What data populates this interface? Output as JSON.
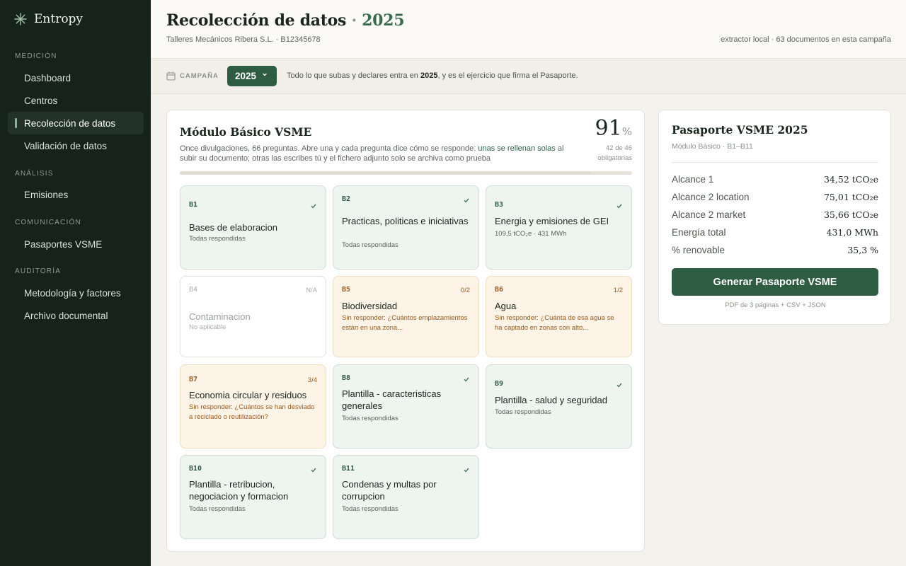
{
  "app": {
    "name": "Entropy"
  },
  "sidebar": {
    "sections": [
      {
        "label": "MEDICIÓN",
        "items": [
          "Dashboard",
          "Centros",
          "Recolección de datos",
          "Validación de datos"
        ]
      },
      {
        "label": "ANÁLISIS",
        "items": [
          "Emisiones"
        ]
      },
      {
        "label": "COMUNICACIÓN",
        "items": [
          "Pasaportes VSME"
        ]
      },
      {
        "label": "AUDITORÍA",
        "items": [
          "Metodología y factores",
          "Archivo documental"
        ]
      }
    ],
    "active_item": "Recolección de datos"
  },
  "header": {
    "title": "Recolección de datos",
    "title_sep": "·",
    "title_year": "2025",
    "company": "Talleres Mecánicos Ribera S.L. · B12345678",
    "right_info": "extractor local · 63 documentos en esta campaña"
  },
  "campaign": {
    "label": "CAMPAÑA",
    "selected_year": "2025",
    "hint_before": "Todo lo que subas y declares entra en ",
    "hint_year": "2025",
    "hint_after": ", y es el ejercicio que firma el Pasaporte."
  },
  "module": {
    "title": "Módulo Básico VSME",
    "desc_before": "Once divulgaciones, 66 preguntas. Abre una y cada pregunta dice cómo se responde: ",
    "desc_highlight": "unas se rellenan solas",
    "desc_after": " al subir su documento; otras las escribes tú y el fichero adjunto solo se archiva como prueba",
    "score": "91",
    "score_unit": "%",
    "score_sub": "42 de 46 obligatorias",
    "progress_fraction": 0.91
  },
  "cards": [
    {
      "code": "B1",
      "title": "Bases de elaboracion",
      "status": "Todas respondidas",
      "state": "done",
      "badge": ""
    },
    {
      "code": "B2",
      "title": "Practicas, politicas e iniciativas",
      "status": "Todas respondidas",
      "state": "done",
      "badge": ""
    },
    {
      "code": "B3",
      "title": "Energia y emisiones de GEI",
      "status": "109,5 tCO₂e · 431 MWh",
      "state": "done",
      "badge": ""
    },
    {
      "code": "B4",
      "title": "Contaminacion",
      "status": "No aplicable",
      "state": "na",
      "badge": "N/A"
    },
    {
      "code": "B5",
      "title": "Biodiversidad",
      "status": "Sin responder: ¿Cuántos emplazamientos están en una zona...",
      "state": "pending",
      "badge": "0/2"
    },
    {
      "code": "B6",
      "title": "Agua",
      "status": "Sin responder: ¿Cuánta de esa agua se ha captado en zonas con alto...",
      "state": "pending",
      "badge": "1/2"
    },
    {
      "code": "B7",
      "title": "Economia circular y residuos",
      "status": "Sin responder: ¿Cuántos se han desviado a reciclado o reutilización?",
      "state": "pending",
      "badge": "3/4"
    },
    {
      "code": "B8",
      "title": "Plantilla - caracteristicas generales",
      "status": "Todas respondidas",
      "state": "done",
      "badge": ""
    },
    {
      "code": "B9",
      "title": "Plantilla - salud y seguridad",
      "status": "Todas respondidas",
      "state": "done",
      "badge": ""
    },
    {
      "code": "B10",
      "title": "Plantilla - retribucion, negociacion y formacion",
      "status": "Todas respondidas",
      "state": "done",
      "badge": ""
    },
    {
      "code": "B11",
      "title": "Condenas y multas por corrupcion",
      "status": "Todas respondidas",
      "state": "done",
      "badge": ""
    }
  ],
  "passport": {
    "title": "Pasaporte VSME 2025",
    "subtitle": "Módulo Básico · B1–B11",
    "rows": [
      {
        "label": "Alcance 1",
        "value": "34,52 tCO₂e"
      },
      {
        "label": "Alcance 2 location",
        "value": "75,01 tCO₂e"
      },
      {
        "label": "Alcance 2 market",
        "value": "35,66 tCO₂e"
      },
      {
        "label": "Energía total",
        "value": "431,0 MWh"
      },
      {
        "label": "% renovable",
        "value": "35,3 %"
      }
    ],
    "button": "Generar Pasaporte VSME",
    "footnote": "PDF de 3 páginas + CSV + JSON"
  },
  "icons": {
    "logo": "asterisk-logo-icon",
    "calendar": "calendar-icon",
    "chevron": "chevron-down-icon",
    "check": "check-icon"
  },
  "colors": {
    "accent": "#2f5d42",
    "sidebar_bg": "#16231c",
    "pending_bg": "#fdf3e6",
    "done_bg": "#eef4ef"
  }
}
